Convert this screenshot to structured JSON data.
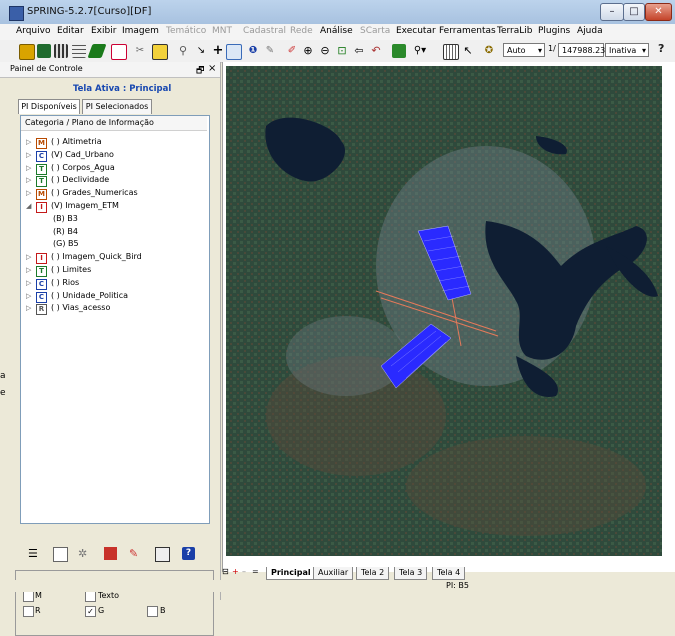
{
  "window": {
    "title": "SPRING-5.2.7[Curso][DF]",
    "minimize": "–",
    "maximize": "□",
    "close": "✕"
  },
  "menu": [
    {
      "label": "Arquivo",
      "enabled": true
    },
    {
      "label": "Editar",
      "enabled": true
    },
    {
      "label": "Exibir",
      "enabled": true
    },
    {
      "label": "Imagem",
      "enabled": true
    },
    {
      "label": "Temático",
      "enabled": false
    },
    {
      "label": "MNT",
      "enabled": false
    },
    {
      "label": "Cadastral",
      "enabled": false
    },
    {
      "label": "Rede",
      "enabled": false
    },
    {
      "label": "Análise",
      "enabled": true
    },
    {
      "label": "SCarta",
      "enabled": false
    },
    {
      "label": "Executar",
      "enabled": true
    },
    {
      "label": "Ferramentas",
      "enabled": true
    },
    {
      "label": "TerraLib",
      "enabled": true
    },
    {
      "label": "Plugins",
      "enabled": true
    },
    {
      "label": "Ajuda",
      "enabled": true
    }
  ],
  "toolbar": {
    "mode_select": "Auto",
    "scale_prefix": "1/",
    "scale_value": "147988.234",
    "state_select": "Inativa",
    "help": "?"
  },
  "panel": {
    "title": "Painel de Controle",
    "pin": "🗗",
    "close": "×",
    "active_screen": "Tela Ativa : Principal",
    "tabs": [
      "PI Disponíveis",
      "PI Selecionados"
    ],
    "tree_header": "Categoria / Plano de Informação",
    "categories": [
      {
        "expander": "▷",
        "badge": "M",
        "badge_color": "#b84a00",
        "label": "( ) Altimetria"
      },
      {
        "expander": "▷",
        "badge": "C",
        "badge_color": "#1a3fa8",
        "label": "(V) Cad_Urbano"
      },
      {
        "expander": "▷",
        "badge": "T",
        "badge_color": "#1b7a2a",
        "label": "( ) Corpos_Agua"
      },
      {
        "expander": "▷",
        "badge": "T",
        "badge_color": "#1b7a2a",
        "label": "( ) Declividade"
      },
      {
        "expander": "▷",
        "badge": "M",
        "badge_color": "#b84a00",
        "label": "( ) Grades_Numericas"
      },
      {
        "expander": "◢",
        "badge": "I",
        "badge_color": "#c41a1a",
        "label": "(V) Imagem_ETM"
      },
      {
        "expander": "▷",
        "badge": "I",
        "badge_color": "#c41a1a",
        "label": "( ) Imagem_Quick_Bird"
      },
      {
        "expander": "▷",
        "badge": "T",
        "badge_color": "#1b7a2a",
        "label": "( ) Limites"
      },
      {
        "expander": "▷",
        "badge": "C",
        "badge_color": "#1a3fa8",
        "label": "( ) Rios"
      },
      {
        "expander": "▷",
        "badge": "C",
        "badge_color": "#1a3fa8",
        "label": "( ) Unidade_Politica"
      },
      {
        "expander": "▷",
        "badge": "R",
        "badge_color": "#555555",
        "label": "( ) Vias_acesso"
      }
    ],
    "bands": [
      "(B) B3",
      "(R) B4",
      "(G) B5"
    ],
    "rgb": [
      {
        "label": "M",
        "checked": false
      },
      {
        "label": "Texto",
        "checked": false
      },
      {
        "label": "R",
        "checked": false
      },
      {
        "label": "G",
        "checked": true
      },
      {
        "label": "B",
        "checked": false
      }
    ]
  },
  "view_tabs": [
    "Principal",
    "Auxiliar",
    "Tela 2",
    "Tela 3",
    "Tela 4"
  ],
  "view_tab_controls": [
    "⊟",
    "+",
    "–",
    "="
  ],
  "status": {
    "pi": "PI: B5"
  },
  "left_edge_fragments": [
    "a",
    "e"
  ],
  "colors": {
    "map_bg": "#2f4a3c",
    "lake": "#0f1e33",
    "grid": "#2a2aff",
    "roads": "#e67a5a",
    "active_title": "#1747b0"
  }
}
